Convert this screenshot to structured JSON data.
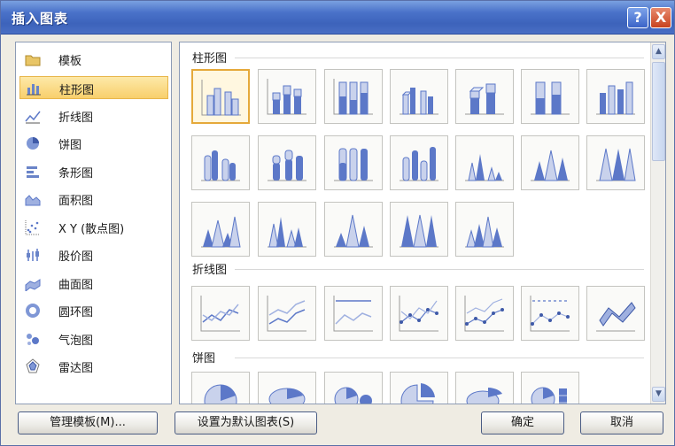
{
  "window": {
    "title": "插入图表"
  },
  "title_buttons": {
    "help": "?",
    "close": "X"
  },
  "categories": [
    {
      "label": "模板",
      "icon": "folder-icon"
    },
    {
      "label": "柱形图",
      "icon": "column-chart-icon",
      "selected": true
    },
    {
      "label": "折线图",
      "icon": "line-chart-icon"
    },
    {
      "label": "饼图",
      "icon": "pie-chart-icon"
    },
    {
      "label": "条形图",
      "icon": "bar-chart-icon"
    },
    {
      "label": "面积图",
      "icon": "area-chart-icon"
    },
    {
      "label": "X Y (散点图)",
      "icon": "scatter-chart-icon"
    },
    {
      "label": "股价图",
      "icon": "stock-chart-icon"
    },
    {
      "label": "曲面图",
      "icon": "surface-chart-icon"
    },
    {
      "label": "圆环图",
      "icon": "doughnut-chart-icon"
    },
    {
      "label": "气泡图",
      "icon": "bubble-chart-icon"
    },
    {
      "label": "雷达图",
      "icon": "radar-chart-icon"
    }
  ],
  "sections": {
    "column": {
      "title": "柱形图"
    },
    "line": {
      "title": "折线图"
    },
    "pie": {
      "title": "饼图"
    }
  },
  "buttons": {
    "manage_templates": "管理模板(M)...",
    "set_default": "设置为默认图表(S)",
    "ok": "确定",
    "cancel": "取消"
  },
  "colors": {
    "accent_blue": "#3d63bb",
    "selection": "#f8cf6c",
    "chart_blue": "#5c78c8"
  }
}
